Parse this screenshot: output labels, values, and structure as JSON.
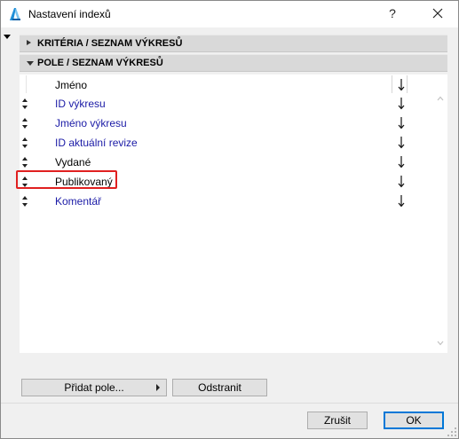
{
  "window": {
    "title": "Nastavení indexů",
    "help_label": "?",
    "icons": {
      "app": "archicad-icon",
      "close": "close-icon"
    }
  },
  "sections": [
    {
      "label": "KRITÉRIA /  SEZNAM VÝKRESŮ",
      "expanded": false
    },
    {
      "label": "POLE /  SEZNAM VÝKRESŮ",
      "expanded": true
    }
  ],
  "fields": [
    {
      "name": "Jméno",
      "color": "#000000",
      "has_handle": false,
      "sort_icon": "sort-arrow-down-icon"
    },
    {
      "name": "ID výkresu",
      "color": "#1a1aa6",
      "has_handle": true,
      "sort_icon": "sort-arrow-down-icon"
    },
    {
      "name": "Jméno výkresu",
      "color": "#1a1aa6",
      "has_handle": true,
      "sort_icon": "sort-arrow-down-icon"
    },
    {
      "name": "ID aktuální revize",
      "color": "#1a1aa6",
      "has_handle": true,
      "sort_icon": "sort-arrow-down-icon"
    },
    {
      "name": "Vydané",
      "color": "#000000",
      "has_handle": true,
      "sort_icon": "sort-arrow-down-icon"
    },
    {
      "name": "Publikovaný",
      "color": "#000000",
      "has_handle": true,
      "sort_icon": "sort-arrow-down-icon",
      "highlighted": true
    },
    {
      "name": "Komentář",
      "color": "#1a1aa6",
      "has_handle": true,
      "sort_icon": "sort-arrow-down-icon"
    }
  ],
  "buttons": {
    "add_field": "Přidat pole...",
    "remove": "Odstranit",
    "cancel": "Zrušit",
    "ok": "OK"
  },
  "colors": {
    "highlight": "#e02020",
    "blue_text": "#1a1aa6",
    "ok_border": "#0078d7"
  }
}
